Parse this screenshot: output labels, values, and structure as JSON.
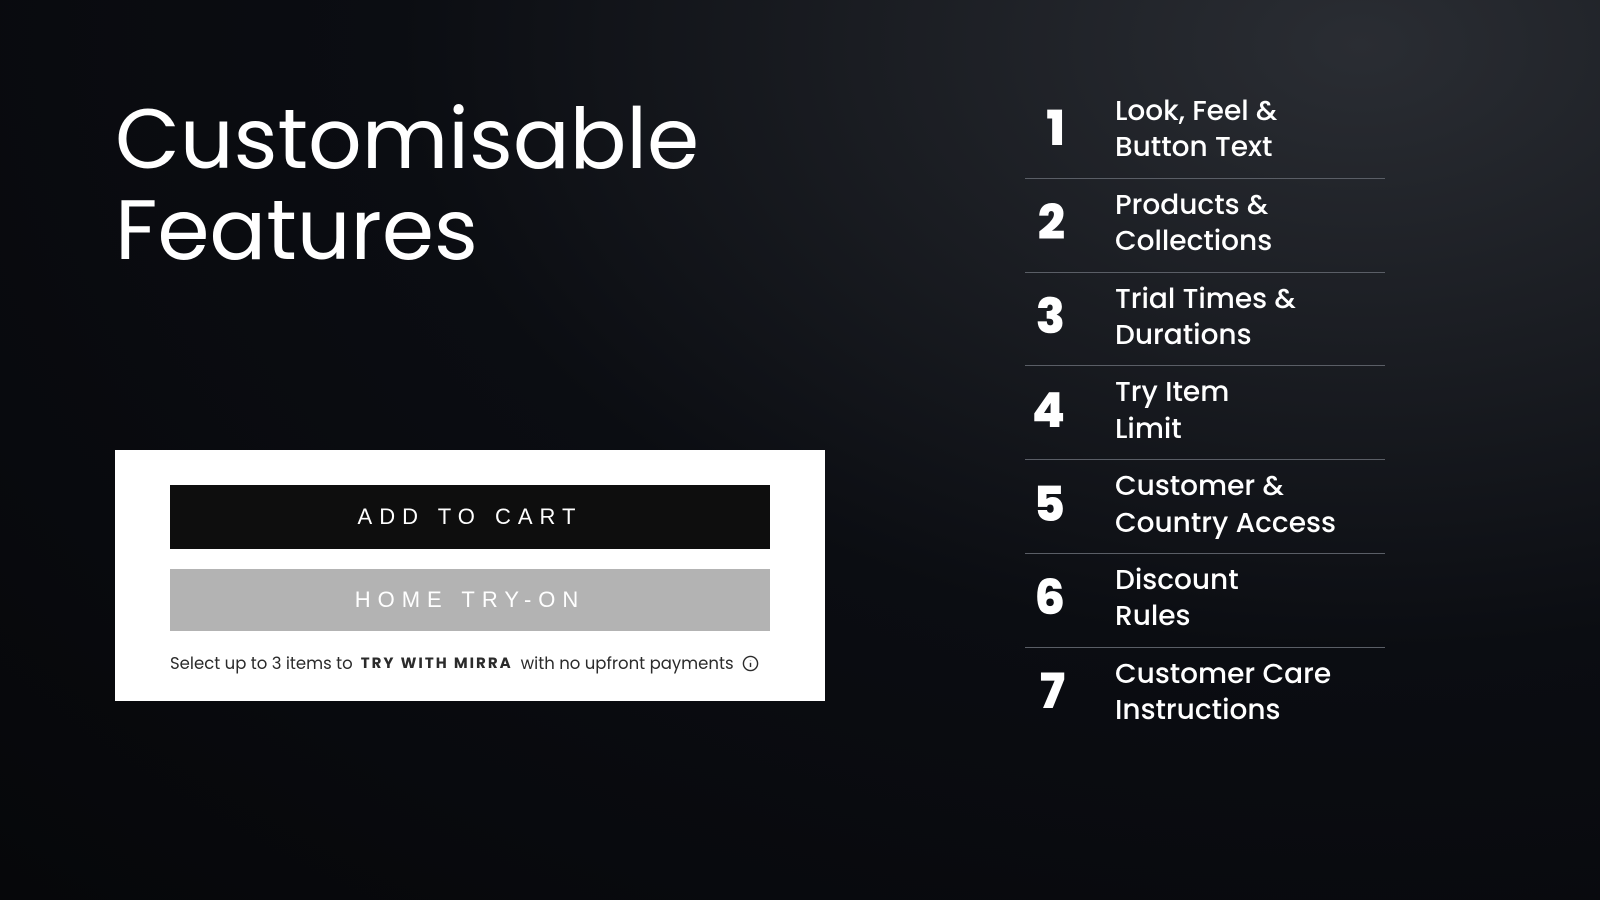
{
  "heading": {
    "line1": "Customisable",
    "line2": "Features"
  },
  "widget": {
    "primary_button": "ADD TO CART",
    "secondary_button": "HOME TRY-ON",
    "caption_prefix": "Select up to 3 items to",
    "brand": "TRY WITH MIRRA",
    "caption_suffix": "with no upfront payments"
  },
  "features": [
    {
      "number": "1",
      "label_line1": "Look, Feel &",
      "label_line2": "Button Text"
    },
    {
      "number": "2",
      "label_line1": "Products &",
      "label_line2": "Collections"
    },
    {
      "number": "3",
      "label_line1": "Trial Times &",
      "label_line2": "Durations"
    },
    {
      "number": "4",
      "label_line1": "Try Item",
      "label_line2": "Limit"
    },
    {
      "number": "5",
      "label_line1": "Customer &",
      "label_line2": "Country Access"
    },
    {
      "number": "6",
      "label_line1": "Discount",
      "label_line2": "Rules"
    },
    {
      "number": "7",
      "label_line1": "Customer Care",
      "label_line2": "Instructions"
    }
  ]
}
